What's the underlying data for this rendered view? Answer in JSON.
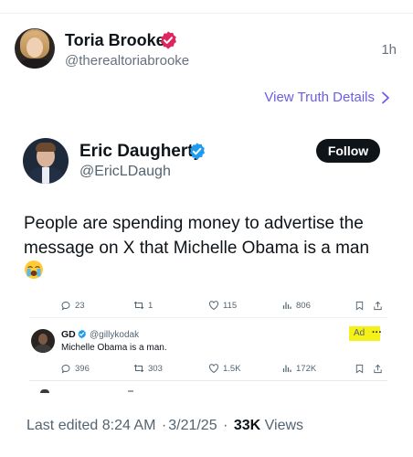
{
  "truth_post": {
    "author_name": "Toria Brooke",
    "author_handle": "@therealtoriabrooke",
    "time": "1h",
    "view_details_label": "View Truth Details"
  },
  "x_post": {
    "author_name": "Eric Daugherty",
    "author_handle": "@EricLDaugh",
    "follow_label": "Follow",
    "text": "People are spending money to advertise the message on X that Michelle Obama is a man",
    "emoji": "loudly-crying-face"
  },
  "embedded": {
    "top_stats": {
      "replies": "23",
      "reposts": "1",
      "likes": "115",
      "views": "806"
    },
    "ad_post": {
      "name": "GD",
      "handle": "@gillykodak",
      "text": "Michelle Obama is a man.",
      "ad_label": "Ad",
      "more": "···"
    },
    "ad_stats": {
      "replies": "396",
      "reposts": "303",
      "likes": "1.5K",
      "views": "172K"
    }
  },
  "footer": {
    "edited_label": "Last edited 8:24 AM",
    "date": "3/21/25",
    "separator": "·",
    "views_count": "33K",
    "views_label": "Views"
  },
  "colors": {
    "truth_accent": "#6c5ce7",
    "verified_blue": "#1d9bf0",
    "ad_highlight": "#f4f018"
  }
}
